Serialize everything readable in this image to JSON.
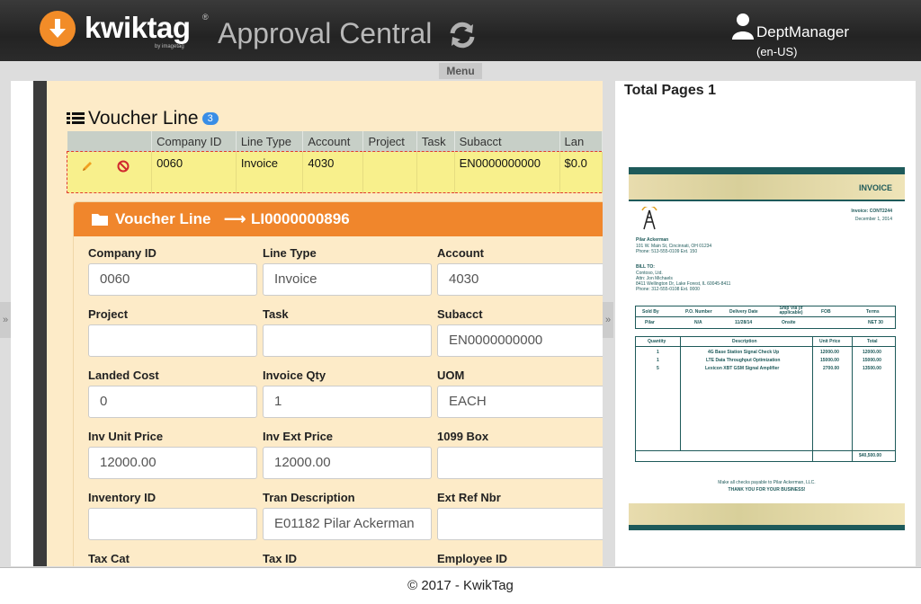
{
  "header": {
    "logo_text": "kwiktag",
    "logo_sub": "by imagetag",
    "app_title": "Approval Central",
    "user_name": "DeptManager",
    "user_locale": "(en-US)",
    "brand_color": "#f28c28"
  },
  "menu": {
    "label": "Menu"
  },
  "voucher_line": {
    "title": "Voucher Line",
    "count": "3",
    "columns": [
      "Company ID",
      "Line Type",
      "Account",
      "Project",
      "Task",
      "Subacct",
      "Lan"
    ],
    "row": [
      "0060",
      "Invoice",
      "4030",
      "",
      "",
      "EN0000000000",
      "$0.0"
    ]
  },
  "form": {
    "title": "Voucher Line",
    "record_id": "LI0000000896",
    "fields": [
      {
        "label": "Company ID",
        "value": "0060"
      },
      {
        "label": "Line Type",
        "value": "Invoice"
      },
      {
        "label": "Account",
        "value": "4030"
      },
      {
        "label": "Project",
        "value": ""
      },
      {
        "label": "Task",
        "value": ""
      },
      {
        "label": "Subacct",
        "value": "EN0000000000"
      },
      {
        "label": "Landed Cost",
        "value": "0"
      },
      {
        "label": "Invoice Qty",
        "value": "1"
      },
      {
        "label": "UOM",
        "value": "EACH"
      },
      {
        "label": "Inv Unit Price",
        "value": "12000.00"
      },
      {
        "label": "Inv Ext Price",
        "value": "12000.00"
      },
      {
        "label": "1099 Box",
        "value": ""
      },
      {
        "label": "Inventory ID",
        "value": ""
      },
      {
        "label": "Tran Description",
        "value": "E01182 Pilar Ackerman"
      },
      {
        "label": "Ext Ref Nbr",
        "value": ""
      },
      {
        "label": "Tax Cat",
        "value": ""
      },
      {
        "label": "Tax ID",
        "value": ""
      },
      {
        "label": "Employee ID",
        "value": ""
      }
    ]
  },
  "preview": {
    "total_pages_label": "Total Pages 1",
    "invoice": {
      "heading": "INVOICE",
      "number": "Invoice: CONT2244",
      "date": "December 1, 2014",
      "from": [
        "Pilar Ackerman",
        "101 W. Main St, Cincinnati, OH 01234",
        "Phone: 513-555-0109 Ext. 150"
      ],
      "bill_to_label": "BILL TO:",
      "bill_to": [
        "Contoso, Ltd.",
        "Attn: Jon Michaels",
        "8411 Wellington Dr, Lake Forest, IL 60045-8411",
        "Phone: 312-555-0108 Ext. 0000"
      ],
      "ship_headers": [
        "Sold By",
        "P.O. Number",
        "Delivery Date",
        "Ship Via (if applicable)",
        "FOB",
        "Terms"
      ],
      "ship_values": [
        "Pilar",
        "N/A",
        "11/28/14",
        "Onsite",
        "",
        "NET 30"
      ],
      "item_headers": [
        "Quantity",
        "Description",
        "Unit Price",
        "Total"
      ],
      "items": [
        {
          "qty": "1",
          "desc": "4G Base Station Signal Check Up",
          "price": "12000.00",
          "total": "12000.00"
        },
        {
          "qty": "1",
          "desc": "LTE Data Throughput Optimization",
          "price": "15000.00",
          "total": "15000.00"
        },
        {
          "qty": "5",
          "desc": "Lexicon XBT GSM Signal Amplifier",
          "price": "2700.00",
          "total": "13500.00"
        }
      ],
      "grand_total": "$40,500.00",
      "payable_note": "Make all checks payable to Pilar Ackerman, LLC.",
      "thanks": "THANK YOU FOR YOUR BUSINESS!"
    }
  },
  "footer": {
    "text": "© 2017 - KwikTag"
  }
}
